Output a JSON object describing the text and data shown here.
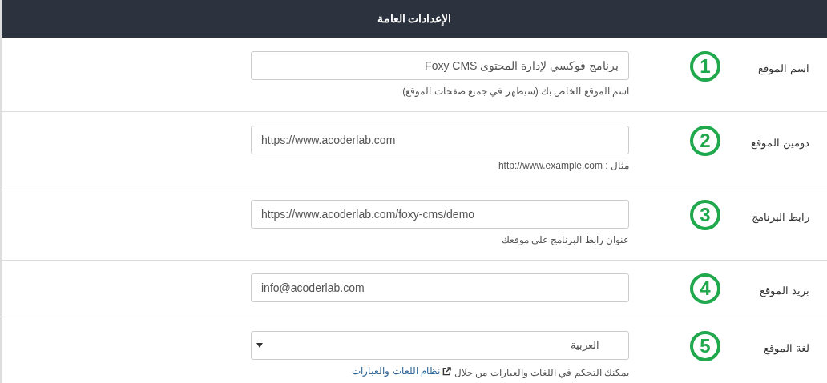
{
  "header": {
    "title": "الإعدادات العامة"
  },
  "fields": [
    {
      "label": "اسم الموقع",
      "step": "1",
      "kind": "text",
      "value": "برنامج فوكسي لإدارة المحتوى Foxy CMS",
      "help": {
        "text": "اسم الموقع الخاص بك (سيظهر في جميع صفحات الموقع)"
      }
    },
    {
      "label": "دومين الموقع",
      "step": "2",
      "kind": "text",
      "value": "https://www.acoderlab.com",
      "help": {
        "text": "مثال : http://www.example.com"
      }
    },
    {
      "label": "رابط البرنامج",
      "step": "3",
      "kind": "text",
      "value": "https://www.acoderlab.com/foxy-cms/demo",
      "help": {
        "text": "عنوان رابط البرنامج على موقعك"
      }
    },
    {
      "label": "بريد الموقع",
      "step": "4",
      "kind": "text",
      "value": "info@acoderlab.com"
    },
    {
      "label": "لغة الموقع",
      "step": "5",
      "kind": "select",
      "value": "العربية",
      "help": {
        "text": "يمكنك التحكم في اللغات والعبارات من خلال",
        "link": "نظام اللغات والعبارات"
      }
    }
  ]
}
